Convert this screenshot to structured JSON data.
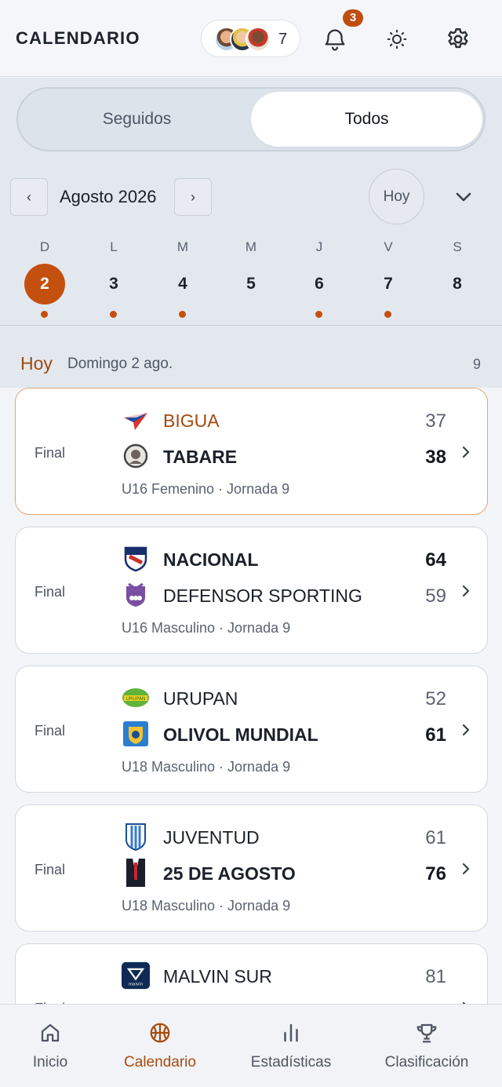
{
  "header": {
    "title": "CALENDARIO",
    "followers_count": "7",
    "notifications_count": "3"
  },
  "tabs": {
    "followed": "Seguidos",
    "all": "Todos",
    "active": "all"
  },
  "calendar": {
    "month_label": "Agosto 2026",
    "prev_label": "‹",
    "next_label": "›",
    "today_button": "Hoy",
    "days": [
      {
        "letter": "D",
        "num": "2",
        "selected": true,
        "has_games": true
      },
      {
        "letter": "L",
        "num": "3",
        "selected": false,
        "has_games": true
      },
      {
        "letter": "M",
        "num": "4",
        "selected": false,
        "has_games": true
      },
      {
        "letter": "M",
        "num": "5",
        "selected": false,
        "has_games": false
      },
      {
        "letter": "J",
        "num": "6",
        "selected": false,
        "has_games": true
      },
      {
        "letter": "V",
        "num": "7",
        "selected": false,
        "has_games": true
      },
      {
        "letter": "S",
        "num": "8",
        "selected": false,
        "has_games": false
      }
    ]
  },
  "date_header": {
    "today": "Hoy",
    "date": "Domingo 2 ago.",
    "count": "9"
  },
  "games": [
    {
      "status": "Final",
      "home": {
        "name": "BIGUA",
        "score": "37",
        "winner": false,
        "logo": "bigua-logo"
      },
      "away": {
        "name": "TABARE",
        "score": "38",
        "winner": true,
        "logo": "tabare-logo"
      },
      "meta": "U16 Femenino · Jornada 9",
      "highlight": true
    },
    {
      "status": "Final",
      "home": {
        "name": "NACIONAL",
        "score": "64",
        "winner": true,
        "logo": "nacional-logo"
      },
      "away": {
        "name": "DEFENSOR SPORTING",
        "score": "59",
        "winner": false,
        "logo": "defensor-logo"
      },
      "meta": "U16 Masculino · Jornada 9"
    },
    {
      "status": "Final",
      "home": {
        "name": "URUPAN",
        "score": "52",
        "winner": false,
        "logo": "urupan-logo"
      },
      "away": {
        "name": "OLIVOL MUNDIAL",
        "score": "61",
        "winner": true,
        "logo": "olivol-logo"
      },
      "meta": "U18 Masculino · Jornada 9"
    },
    {
      "status": "Final",
      "home": {
        "name": "JUVENTUD",
        "score": "61",
        "winner": false,
        "logo": "juventud-logo"
      },
      "away": {
        "name": "25 DE AGOSTO",
        "score": "76",
        "winner": true,
        "logo": "25-de-agosto-logo"
      },
      "meta": "U18 Masculino · Jornada 9"
    },
    {
      "status": "Final",
      "home": {
        "name": "MALVIN SUR",
        "score": "81",
        "winner": false,
        "logo": "malvin-logo"
      },
      "away": {
        "name": "",
        "score": "",
        "winner": false,
        "logo": ""
      },
      "meta": ""
    }
  ],
  "bottom_nav": [
    {
      "label": "Inicio",
      "icon": "home-icon",
      "active": false
    },
    {
      "label": "Calendario",
      "icon": "basketball-icon",
      "active": true
    },
    {
      "label": "Estadísticas",
      "icon": "stats-icon",
      "active": false
    },
    {
      "label": "Clasificación",
      "icon": "trophy-icon",
      "active": false
    }
  ],
  "colors": {
    "accent": "#c4500f",
    "accent_text": "#a84c10"
  }
}
